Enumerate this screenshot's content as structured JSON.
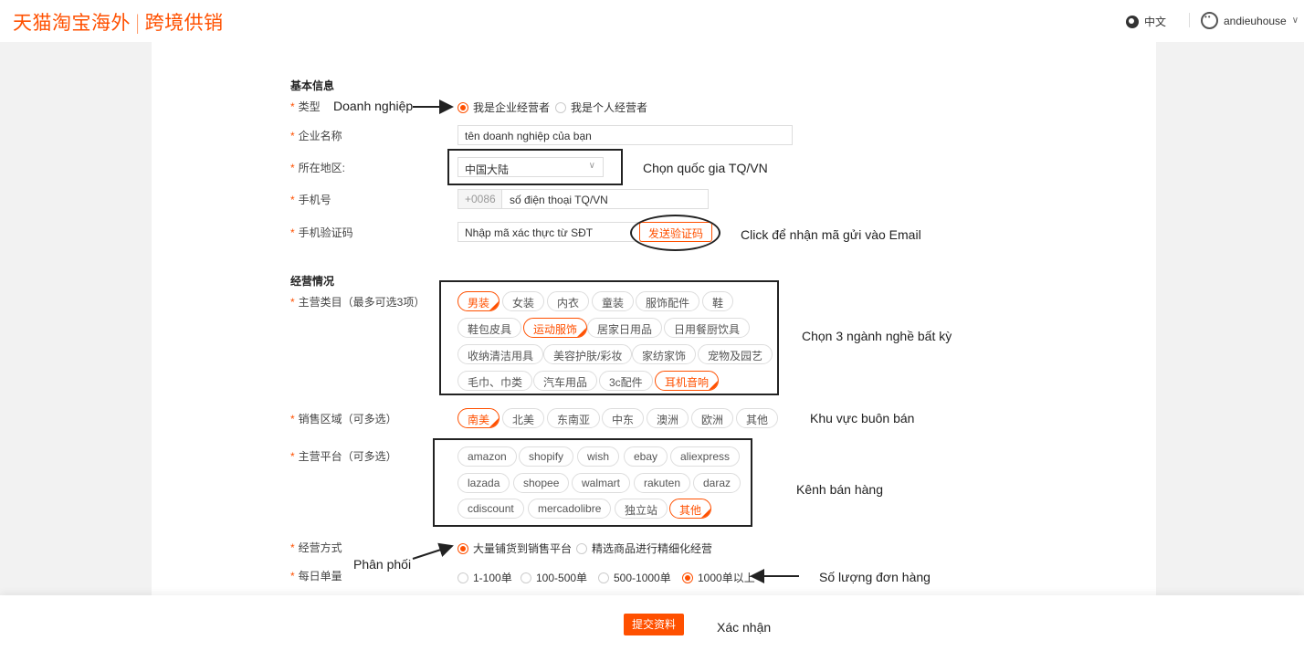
{
  "header": {
    "logo_main": "天猫淘宝海外",
    "logo_sep": "|",
    "logo_sub": "跨境供销",
    "language": "中文",
    "username": "andieuhouse"
  },
  "basic": {
    "section_title": "基本信息",
    "type_label": "类型",
    "type_options": [
      "我是企业经营者",
      "我是个人经营者"
    ],
    "type_selected": 0,
    "company_label": "企业名称",
    "company_value": "tên doanh nghiệp của bạn",
    "region_label": "所在地区:",
    "region_value": "中国大陆",
    "phone_label": "手机号",
    "phone_prefix": "+0086",
    "phone_value": "số điện thoại TQ/VN",
    "code_label": "手机验证码",
    "code_value": "Nhập mã xác thực từ SĐT",
    "send_code": "发送验证码"
  },
  "business": {
    "section_title": "经营情况",
    "category_label": "主营类目（最多可选3项）",
    "categories": [
      "男装",
      "女装",
      "内衣",
      "童装",
      "服饰配件",
      "鞋",
      "鞋包皮具",
      "运动服饰",
      "居家日用品",
      "日用餐厨饮具",
      "收纳清洁用具",
      "美容护肤/彩妆",
      "家纺家饰",
      "宠物及园艺",
      "毛巾、巾类",
      "汽车用品",
      "3c配件",
      "耳机音响"
    ],
    "region_label": "销售区域（可多选）",
    "regions": [
      "南美",
      "北美",
      "东南亚",
      "中东",
      "澳洲",
      "欧洲",
      "其他"
    ],
    "platform_label": "主营平台（可多选）",
    "platforms": [
      "amazon",
      "shopify",
      "wish",
      "ebay",
      "aliexpress",
      "lazada",
      "shopee",
      "walmart",
      "rakuten",
      "daraz",
      "cdiscount",
      "mercadolibre",
      "独立站",
      "其他"
    ],
    "mode_label": "经营方式",
    "modes": [
      "大量铺货到销售平台",
      "精选商品进行精细化经营"
    ],
    "mode_selected": 0,
    "orders_label": "每日单量",
    "orders": [
      "1-100单",
      "100-500单",
      "500-1000单",
      "1000单以上"
    ],
    "orders_selected": 3
  },
  "annotations": {
    "doanh_nghiep": "Doanh nghiệp",
    "chon_quoc_gia": "Chọn quốc gia TQ/VN",
    "click_email": "Click để nhận mã gửi vào Email",
    "chon_nganh": "Chọn 3 ngành nghề bất kỳ",
    "khu_vuc": "Khu vực buôn bán",
    "kenh_ban": "Kênh bán hàng",
    "phan_phoi": "Phân phối",
    "so_luong": "Số lượng đơn hàng",
    "xac_nhan": "Xác nhận"
  },
  "footer": {
    "submit": "提交资料"
  },
  "colors": {
    "accent": "#ff5000",
    "text": "#333333",
    "border": "#dddddd"
  }
}
